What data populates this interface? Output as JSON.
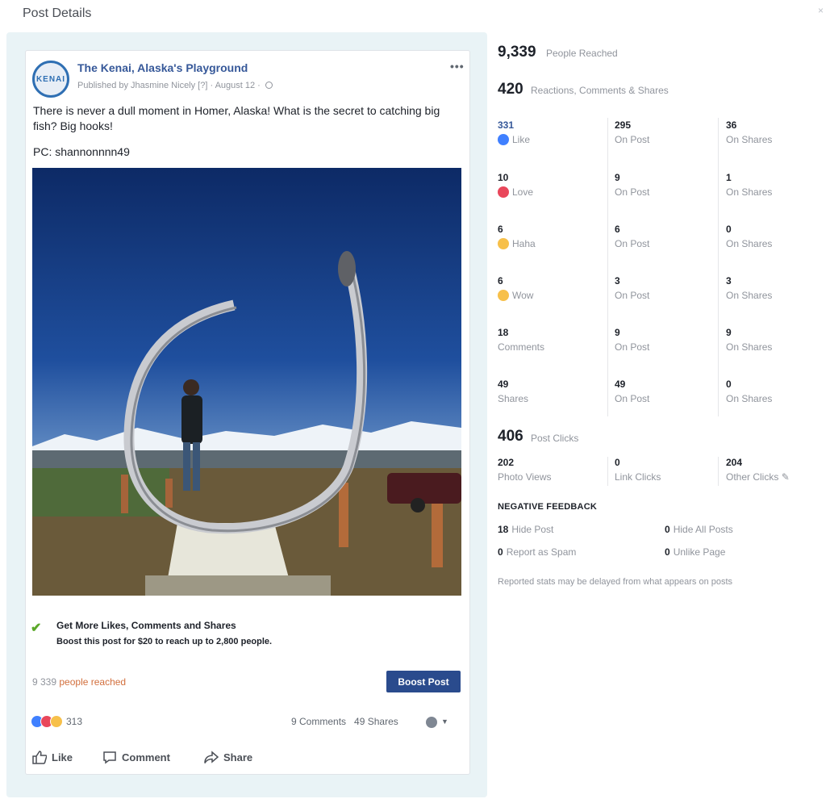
{
  "dialog": {
    "title": "Post Details",
    "close": "×"
  },
  "post": {
    "page_name": "The Kenai, Alaska's Playground",
    "logo_text": "KENAI",
    "meta": "Published by Jhasmine Nicely [?] · August 12 ·",
    "text": "There is never a dull moment in Homer, Alaska! What is the secret to catching big fish? Big hooks!",
    "pc": "PC: shannonnnn49",
    "more": "•••"
  },
  "boost": {
    "title": "Get More Likes, Comments and Shares",
    "desc": "Boost this post for $20 to reach up to 2,800 people.",
    "button": "Boost Post"
  },
  "reach_line": {
    "count": "9 339",
    "label": "people reached"
  },
  "engagement": {
    "reactions_count": "313",
    "comments": "9 Comments",
    "shares": "49 Shares"
  },
  "actions": {
    "like": "Like",
    "comment": "Comment",
    "share": "Share"
  },
  "stats": {
    "people_reached": {
      "value": "9,339",
      "label": "People Reached"
    },
    "engagements": {
      "value": "420",
      "label": "Reactions, Comments & Shares"
    },
    "rows": [
      {
        "total": "331",
        "label": "Like",
        "on_post": "295",
        "on_shares": "36",
        "icon_color": "#4080ff",
        "icon": "like-icon"
      },
      {
        "total": "10",
        "label": "Love",
        "on_post": "9",
        "on_shares": "1",
        "icon_color": "#e9475b",
        "icon": "love-icon"
      },
      {
        "total": "6",
        "label": "Haha",
        "on_post": "6",
        "on_shares": "0",
        "icon_color": "#f7c04a",
        "icon": "haha-icon"
      },
      {
        "total": "6",
        "label": "Wow",
        "on_post": "3",
        "on_shares": "3",
        "icon_color": "#f7c04a",
        "icon": "wow-icon"
      },
      {
        "total": "18",
        "label": "Comments",
        "on_post": "9",
        "on_shares": "9"
      },
      {
        "total": "49",
        "label": "Shares",
        "on_post": "49",
        "on_shares": "0"
      }
    ],
    "on_post_label": "On Post",
    "on_shares_label": "On Shares",
    "post_clicks": {
      "value": "406",
      "label": "Post Clicks"
    },
    "clicks": [
      {
        "value": "202",
        "label": "Photo Views"
      },
      {
        "value": "0",
        "label": "Link Clicks"
      },
      {
        "value": "204",
        "label": "Other Clicks"
      }
    ],
    "negative": {
      "title": "NEGATIVE FEEDBACK",
      "items": [
        {
          "value": "18",
          "label": "Hide Post"
        },
        {
          "value": "0",
          "label": "Hide All Posts"
        },
        {
          "value": "0",
          "label": "Report as Spam"
        },
        {
          "value": "0",
          "label": "Unlike Page"
        }
      ]
    },
    "footnote": "Reported stats may be delayed from what appears on posts"
  }
}
